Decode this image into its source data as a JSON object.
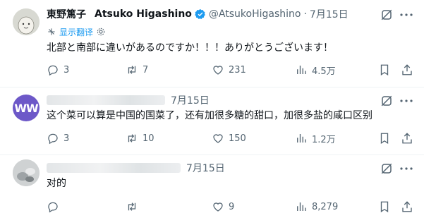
{
  "posts": [
    {
      "author_name": "東野篤子",
      "display_name": "Atsuko Higashino",
      "handle": "@AtsukoHigashino",
      "separator": "·",
      "date": "7月15日",
      "translate_label": "显示翻译",
      "text": "北部と南部に違いがあるのですか！！！ありがとうございます！",
      "replies": "3",
      "reposts": "7",
      "likes": "231",
      "views": "4.5万"
    },
    {
      "avatar_initials": "WW",
      "date": "7月15日",
      "text": "这个菜可以算是中国的国菜了，还有加很多糖的甜口，加很多盐的咸口区别",
      "replies": "3",
      "reposts": "10",
      "likes": "150",
      "views": "1.2万"
    },
    {
      "date": "7月15日",
      "text": "对的",
      "replies": "",
      "reposts": "",
      "likes": "9",
      "views": "8,279"
    }
  ],
  "colors": {
    "accent": "#1d9bf0",
    "muted": "#536471",
    "text": "#0f1419",
    "divider": "#eff3f4"
  },
  "icons": [
    "reply-icon",
    "repost-icon",
    "like-icon",
    "views-icon",
    "bookmark-icon",
    "share-icon",
    "grok-icon",
    "more-icon",
    "verified-icon",
    "settings-icon"
  ]
}
